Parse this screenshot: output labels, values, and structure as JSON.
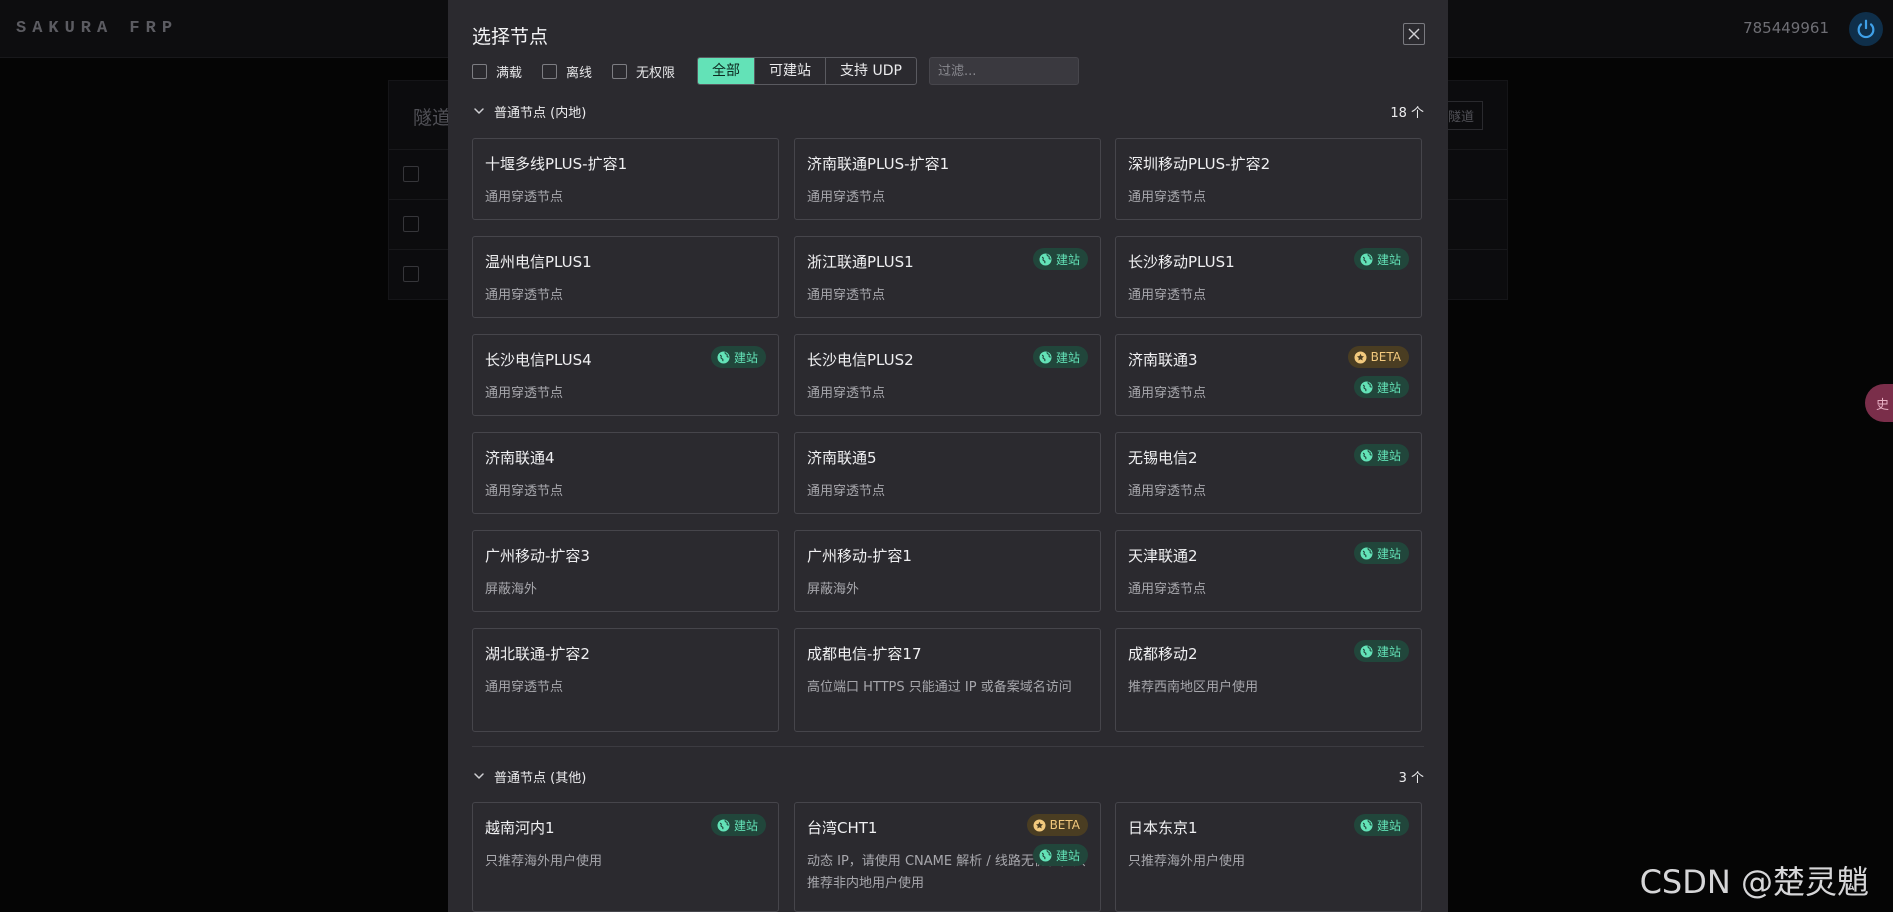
{
  "app": {
    "brand": "SAKURA FRP",
    "user_id": "785449961",
    "side_tab": "史"
  },
  "background": {
    "tunnel_title": "隧道",
    "tunnel_button": "隧道"
  },
  "modal": {
    "title": "选择节点",
    "filters": {
      "checkboxes": [
        {
          "label": "满载",
          "checked": false
        },
        {
          "label": "离线",
          "checked": false
        },
        {
          "label": "无权限",
          "checked": false
        }
      ],
      "segments": [
        {
          "label": "全部",
          "active": true
        },
        {
          "label": "可建站",
          "active": false
        },
        {
          "label": "支持 UDP",
          "active": false
        }
      ],
      "search_placeholder": "过滤..."
    },
    "groups": [
      {
        "name": "普通节点 (内地)",
        "count": "18 个",
        "nodes": [
          {
            "name": "十堰多线PLUS-扩容1",
            "desc": "通用穿透节点",
            "badges": []
          },
          {
            "name": "济南联通PLUS-扩容1",
            "desc": "通用穿透节点",
            "badges": []
          },
          {
            "name": "深圳移动PLUS-扩容2",
            "desc": "通用穿透节点",
            "badges": []
          },
          {
            "name": "温州电信PLUS1",
            "desc": "通用穿透节点",
            "badges": []
          },
          {
            "name": "浙江联通PLUS1",
            "desc": "通用穿透节点",
            "badges": [
              "建站"
            ]
          },
          {
            "name": "长沙移动PLUS1",
            "desc": "通用穿透节点",
            "badges": [
              "建站"
            ]
          },
          {
            "name": "长沙电信PLUS4",
            "desc": "通用穿透节点",
            "badges": [
              "建站"
            ]
          },
          {
            "name": "长沙电信PLUS2",
            "desc": "通用穿透节点",
            "badges": [
              "建站"
            ]
          },
          {
            "name": "济南联通3",
            "desc": "通用穿透节点",
            "badges": [
              "BETA",
              "建站"
            ]
          },
          {
            "name": "济南联通4",
            "desc": "通用穿透节点",
            "badges": []
          },
          {
            "name": "济南联通5",
            "desc": "通用穿透节点",
            "badges": []
          },
          {
            "name": "无锡电信2",
            "desc": "通用穿透节点",
            "badges": [
              "建站"
            ]
          },
          {
            "name": "广州移动-扩容3",
            "desc": "屏蔽海外",
            "badges": []
          },
          {
            "name": "广州移动-扩容1",
            "desc": "屏蔽海外",
            "badges": []
          },
          {
            "name": "天津联通2",
            "desc": "通用穿透节点",
            "badges": [
              "建站"
            ]
          },
          {
            "name": "湖北联通-扩容2",
            "desc": "通用穿透节点",
            "badges": []
          },
          {
            "name": "成都电信-扩容17",
            "desc": "高位端口 HTTPS 只能通过 IP 或备案域名访问",
            "badges": []
          },
          {
            "name": "成都移动2",
            "desc": "推荐西南地区用户使用",
            "badges": [
              "建站"
            ]
          }
        ]
      },
      {
        "name": "普通节点 (其他)",
        "count": "3 个",
        "nodes": [
          {
            "name": "越南河内1",
            "desc": "只推荐海外用户使用",
            "badges": [
              "建站"
            ]
          },
          {
            "name": "台湾CHT1",
            "desc": "动态 IP，请使用 CNAME 解析 / 线路无优化，只推荐非内地用户使用",
            "badges": [
              "BETA",
              "建站"
            ]
          },
          {
            "name": "日本东京1",
            "desc": "只推荐海外用户使用",
            "badges": [
              "建站"
            ]
          }
        ]
      }
    ]
  },
  "watermark": "CSDN @楚灵魈",
  "icons": {
    "close": "close-icon",
    "chevron": "chevron-down-icon",
    "web": "globe-icon",
    "beta": "star-icon",
    "power": "power-icon"
  },
  "colors": {
    "accent": "#63e2b7",
    "beta": "#f2c97d",
    "modal_bg": "#2b2a2f"
  }
}
